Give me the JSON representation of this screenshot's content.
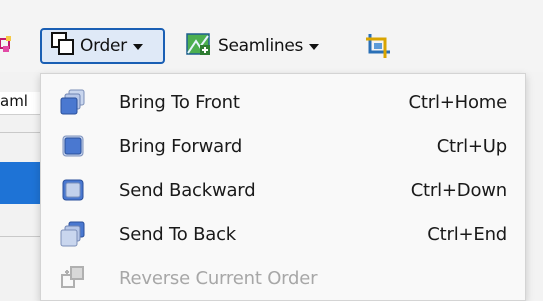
{
  "toolbar": {
    "order_label": "Order",
    "seamlines_label": "Seamlines"
  },
  "segment": {
    "partial_label": "aml"
  },
  "menu": {
    "items": [
      {
        "label": "Bring To Front",
        "shortcut": "Ctrl+Home",
        "icon": "bring-to-front-icon",
        "enabled": true
      },
      {
        "label": "Bring Forward",
        "shortcut": "Ctrl+Up",
        "icon": "bring-forward-icon",
        "enabled": true
      },
      {
        "label": "Send Backward",
        "shortcut": "Ctrl+Down",
        "icon": "send-backward-icon",
        "enabled": true
      },
      {
        "label": "Send To Back",
        "shortcut": "Ctrl+End",
        "icon": "send-to-back-icon",
        "enabled": true
      },
      {
        "label": "Reverse Current Order",
        "shortcut": "",
        "icon": "reverse-order-icon",
        "enabled": false
      }
    ]
  },
  "colors": {
    "accent": "#1a5fb4",
    "selection": "#1e73d6",
    "disabled_text": "#a7a7a7"
  }
}
